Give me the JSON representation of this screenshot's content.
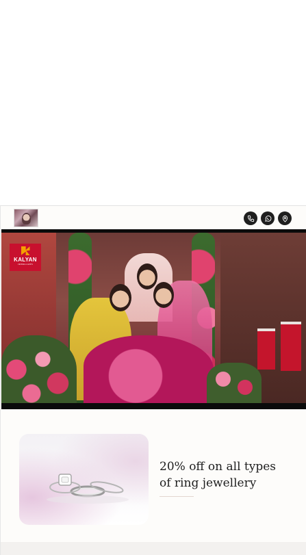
{
  "header": {
    "actions": [
      {
        "icon": "phone-icon",
        "color": "#1f1f1f"
      },
      {
        "icon": "whatsapp-icon",
        "color": "#1f1f1f"
      },
      {
        "icon": "location-pin-icon",
        "color": "#1f1f1f"
      }
    ]
  },
  "video": {
    "brand_name": "KALYAN",
    "brand_sub": "JEWELLERS",
    "brand_color": "#c8102e"
  },
  "promo": {
    "title": "20% off on all types of ring jewellery"
  }
}
